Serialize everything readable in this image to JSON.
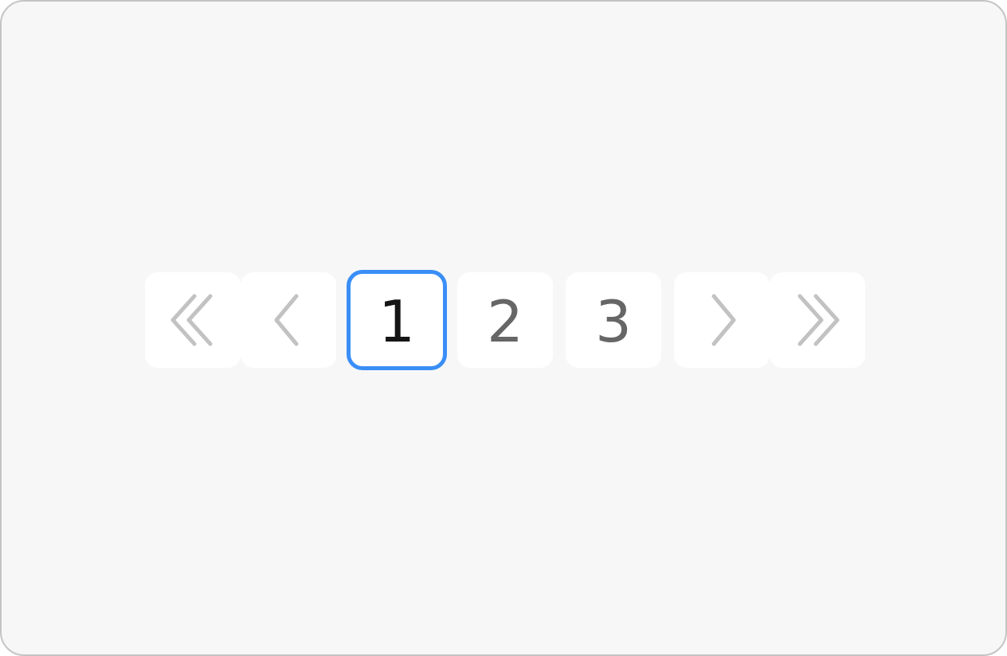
{
  "pagination": {
    "first": {
      "icon": "double-chevron-left-icon"
    },
    "prev": {
      "icon": "chevron-left-icon"
    },
    "pages": [
      {
        "label": "1",
        "active": true
      },
      {
        "label": "2",
        "active": false
      },
      {
        "label": "3",
        "active": false
      }
    ],
    "next": {
      "icon": "chevron-right-icon"
    },
    "last": {
      "icon": "double-chevron-right-icon"
    }
  },
  "colors": {
    "background": "#f7f7f7",
    "button": "#ffffff",
    "active_border": "#3a8ef6",
    "icon": "#c2c2c2",
    "page_text": "#666666",
    "active_text": "#151515"
  }
}
